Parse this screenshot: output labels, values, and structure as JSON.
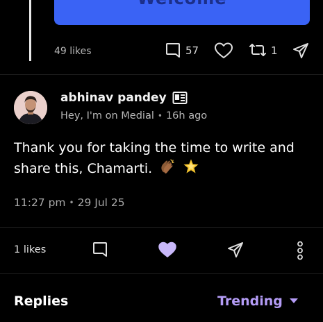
{
  "colors": {
    "accent": "#b49cf6",
    "button_blue": "#3a63f5",
    "background": "#000000"
  },
  "previous_post": {
    "button_label": "Welcome",
    "likes_text": "49 likes",
    "comments_count": "57",
    "reposts_count": "1",
    "icons": [
      "comment-icon",
      "heart-icon",
      "repost-icon",
      "share-icon"
    ]
  },
  "comment": {
    "author_name": "abhinav pandey",
    "author_badge_icon": "id-card-icon",
    "headline": "Hey, I'm on Medial",
    "time_ago": "16h ago",
    "text": "Thank you for taking the time to write and share this, Chamarti.",
    "emojis": [
      "clapping-hands-emoji",
      "glowing-star-emoji"
    ],
    "time": "11:27 pm",
    "date": "29 Jul 25",
    "likes_text": "1 likes",
    "liked": true
  },
  "replies": {
    "label": "Replies",
    "sort_selected": "Trending"
  }
}
